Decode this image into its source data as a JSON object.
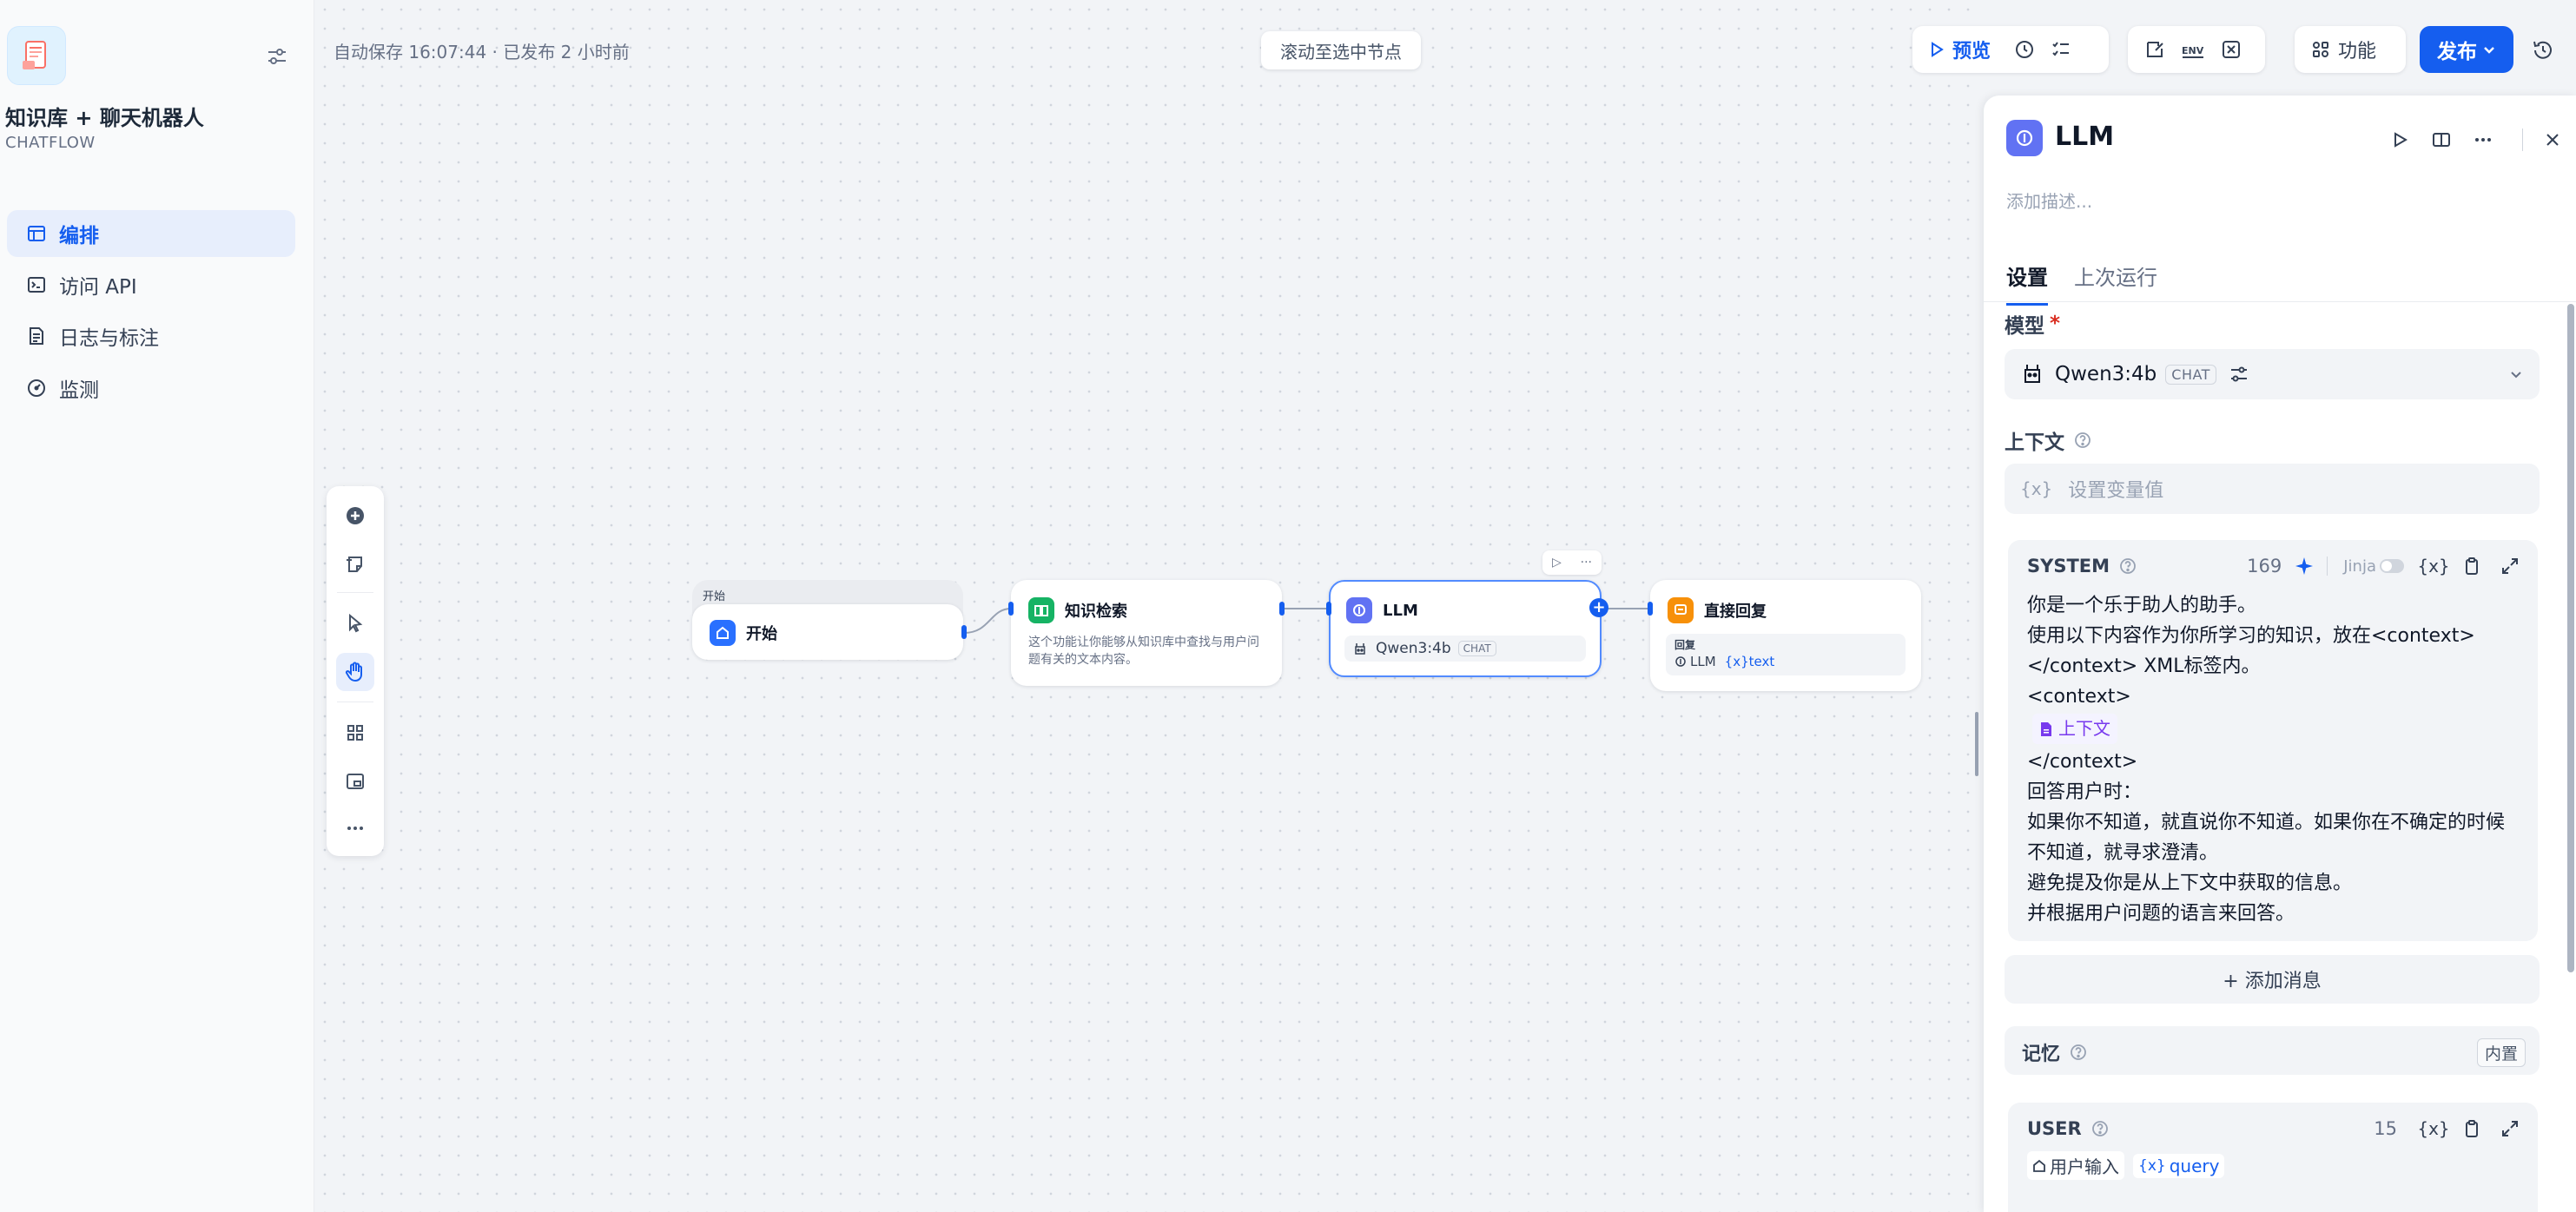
{
  "app": {
    "name": "知识库 + 聊天机器人",
    "mode": "CHATFLOW"
  },
  "sidebar": {
    "items": [
      {
        "label": "编排",
        "icon": "orchestrate-icon",
        "active": true
      },
      {
        "label": "访问 API",
        "icon": "terminal-icon",
        "active": false
      },
      {
        "label": "日志与标注",
        "icon": "logs-icon",
        "active": false
      },
      {
        "label": "监测",
        "icon": "monitor-icon",
        "active": false
      }
    ]
  },
  "header": {
    "autosave": "自动保存 16:07:44 · 已发布 2 小时前",
    "scroll_to_node": "滚动至选中节点",
    "preview": "预览",
    "features": "功能",
    "publish": "发布"
  },
  "nodes": {
    "start": {
      "tab": "开始",
      "title": "开始"
    },
    "knowledge": {
      "title": "知识检索",
      "desc": "这个功能让你能够从知识库中查找与用户问题有关的文本内容。"
    },
    "llm": {
      "title": "LLM",
      "model": "Qwen3:4b",
      "badge": "CHAT"
    },
    "answer": {
      "title": "直接回复",
      "reply_label": "回复",
      "var_source": "LLM",
      "var_name": "{x}text"
    }
  },
  "panel": {
    "title": "LLM",
    "desc_placeholder": "添加描述...",
    "tabs": [
      "设置",
      "上次运行"
    ],
    "model_label": "模型",
    "required_mark": "*",
    "model_name": "Qwen3:4b",
    "model_badge": "CHAT",
    "context_label": "上下文",
    "context_placeholder": "设置变量值",
    "system": {
      "label": "SYSTEM",
      "count": "169",
      "jinja": "Jinja",
      "lines_before": [
        "你是一个乐于助人的助手。",
        "使用以下内容作为你所学习的知识，放在<context></context> XML标签内。",
        "<context>"
      ],
      "context_chip": "上下文",
      "lines_after": [
        "</context>",
        "回答用户时：",
        "如果你不知道，就直说你不知道。如果你在不确定的时候不知道，就寻求澄清。",
        "避免提及你是从上下文中获取的信息。",
        "并根据用户问题的语言来回答。"
      ]
    },
    "add_message": "+ 添加消息",
    "memory_label": "记忆",
    "memory_badge": "内置",
    "user": {
      "label": "USER",
      "count": "15",
      "var1": "用户输入",
      "var2": "query"
    }
  },
  "colors": {
    "accent": "#155eef",
    "llm_icon": "#6172f3",
    "knowledge_icon": "#16b364",
    "answer_icon": "#f79009",
    "start_icon": "#2970ff",
    "context_chip": "#7839ee"
  }
}
